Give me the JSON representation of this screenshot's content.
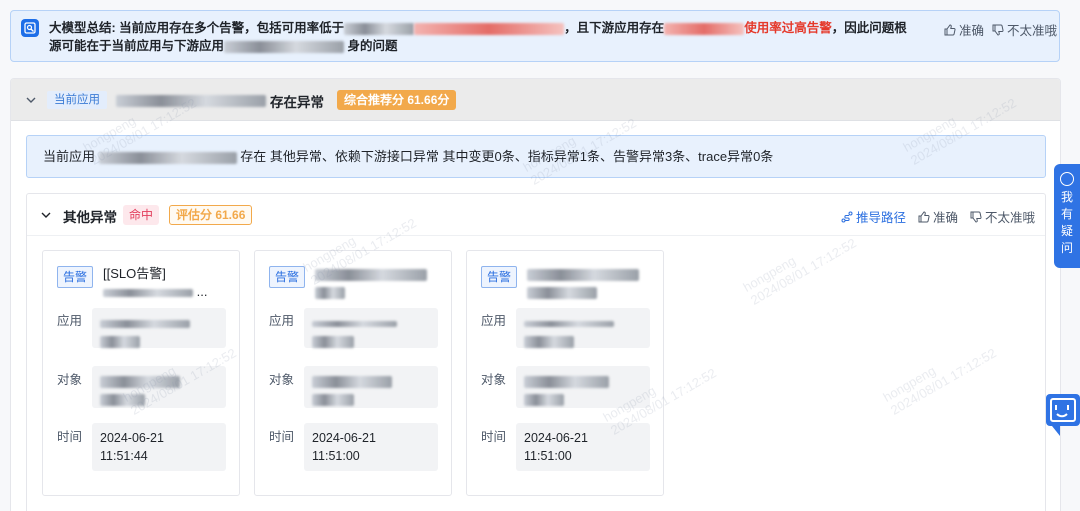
{
  "summary": {
    "label": "大模型总结:",
    "text_a": "当前应用存在多个告警，包括可用率低于",
    "text_b": "，且下游应用存在",
    "text_c_red": "使用率过高告警",
    "text_d": "，因此问题根",
    "text_e": "源可能在于当前应用与下游应用",
    "text_f": "身的问题",
    "accurate": "准确",
    "inaccurate": "不太准哦"
  },
  "section": {
    "app_tag": "当前应用",
    "title_suffix": "存在异常",
    "score": "综合推荐分 61.66分",
    "info_prefix": "当前应用",
    "info_suffix": "存在 其他异常、依赖下游接口异常 其中变更0条、指标异常1条、告警异常3条、trace异常0条"
  },
  "anomaly": {
    "title": "其他异常",
    "hit": "命中",
    "eval_score": "评估分 61.66",
    "derive_path": "推导路径",
    "accurate": "准确",
    "inaccurate": "不太准哦"
  },
  "cards": [
    {
      "tag": "告警",
      "title": "[[SLO告警]",
      "title2": "...",
      "app_label": "应用",
      "obj_label": "对象",
      "time_label": "时间",
      "time": "2024-06-21 11:51:44"
    },
    {
      "tag": "告警",
      "title": "",
      "title2": "",
      "app_label": "应用",
      "obj_label": "对象",
      "time_label": "时间",
      "time": "2024-06-21 11:51:00"
    },
    {
      "tag": "告警",
      "title": "",
      "title2": "",
      "app_label": "应用",
      "obj_label": "对象",
      "time_label": "时间",
      "time": "2024-06-21 11:51:00"
    }
  ],
  "float_help": {
    "text": [
      "我",
      "有",
      "疑",
      "问"
    ]
  },
  "watermark": {
    "user": "hongpeng",
    "time": "2024/08/01 17:12:52"
  },
  "colors": {
    "primary": "#2f73e4",
    "warning": "#f2a94b",
    "danger": "#e23c5b",
    "info_bg": "#e8f1fd"
  }
}
